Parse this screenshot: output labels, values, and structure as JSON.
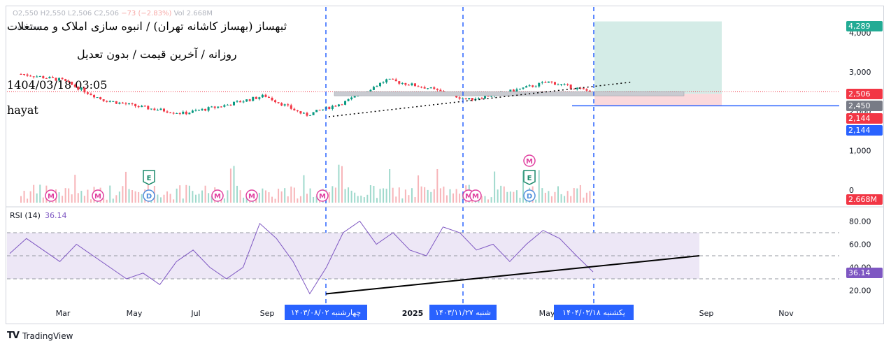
{
  "symbol": {
    "title": "ثبهساز (بهساز کاشانه تهران) / انبوه سازی املاک و مستغلات",
    "subtitle": "روزانه / آخرین قیمت / بدون تعدیل",
    "datetime": "1404/03/18 03:05",
    "author": "hayat",
    "ohlc_text": "O2,550  H2,550  L2,506  C2,506",
    "change_text": "−73 (−2.83%)",
    "vol_text": "Vol 2.668M",
    "volume_label": "Volume"
  },
  "price_axis": {
    "ticks": [
      "4,000",
      "3,000",
      "2,000",
      "1,000",
      "0"
    ],
    "labels": {
      "target": "4,289",
      "last": "2,506",
      "entry": "2,450",
      "stop1": "2,144",
      "stop2": "2,144",
      "volume": "2.668M"
    },
    "colors": {
      "target": "#22ab94",
      "last": "#f23645",
      "entry": "#787b86",
      "stop1": "#f23645",
      "stop2": "#2962ff",
      "volume": "#f23645"
    }
  },
  "rsi": {
    "label": "RSI (14)",
    "value": "36.14",
    "ticks": [
      "80.00",
      "60.00",
      "40.00",
      "20.00"
    ],
    "band_upper": 70,
    "band_mid": 50,
    "band_lower": 30
  },
  "time_axis": {
    "ticks": [
      "Mar",
      "May",
      "Jul",
      "Sep",
      "2025",
      "May",
      "Sep",
      "Nov"
    ],
    "markers": [
      "چهارشنبه ۱۴۰۳/۰۸/۰۲",
      "شنبه ۱۴۰۳/۱۱/۲۷",
      "یکشنبه ۱۴۰۴/۰۳/۱۸"
    ]
  },
  "events": {
    "m_letter": "M",
    "e_letter": "E",
    "d_letter": "D"
  },
  "brand": "TradingView",
  "chart_data": {
    "type": "line",
    "series": [
      {
        "name": "",
        "x": [
          "2024-04",
          "2024-05",
          "2024-06",
          "2024-07",
          "2024-08",
          "2024-09",
          "2024-10",
          "2024-11",
          "2024-12",
          "2025-01",
          "2025-02",
          "2025-03",
          "2025-04",
          "2025-05",
          "2025-06"
        ],
        "values": [
          2950,
          2800,
          2300,
          2100,
          1950,
          2150,
          2400,
          1900,
          2250,
          2800,
          2600,
          2300,
          2500,
          2750,
          2506
        ]
      }
    ],
    "rsi_values": [
      52,
      65,
      55,
      45,
      60,
      50,
      40,
      30,
      35,
      25,
      45,
      55,
      40,
      30,
      40,
      78,
      65,
      45,
      17,
      40,
      70,
      80,
      60,
      70,
      55,
      50,
      75,
      70,
      55,
      60,
      45,
      60,
      72,
      65,
      50,
      36
    ],
    "ylim": [
      0,
      4300
    ],
    "rsi_ylim": [
      10,
      90
    ],
    "colors": {
      "up": "#089981",
      "down": "#f23645",
      "rsi": "#7e57c2",
      "target_zone": "#d4ece7",
      "stop_zone": "#fbd9dc"
    }
  }
}
